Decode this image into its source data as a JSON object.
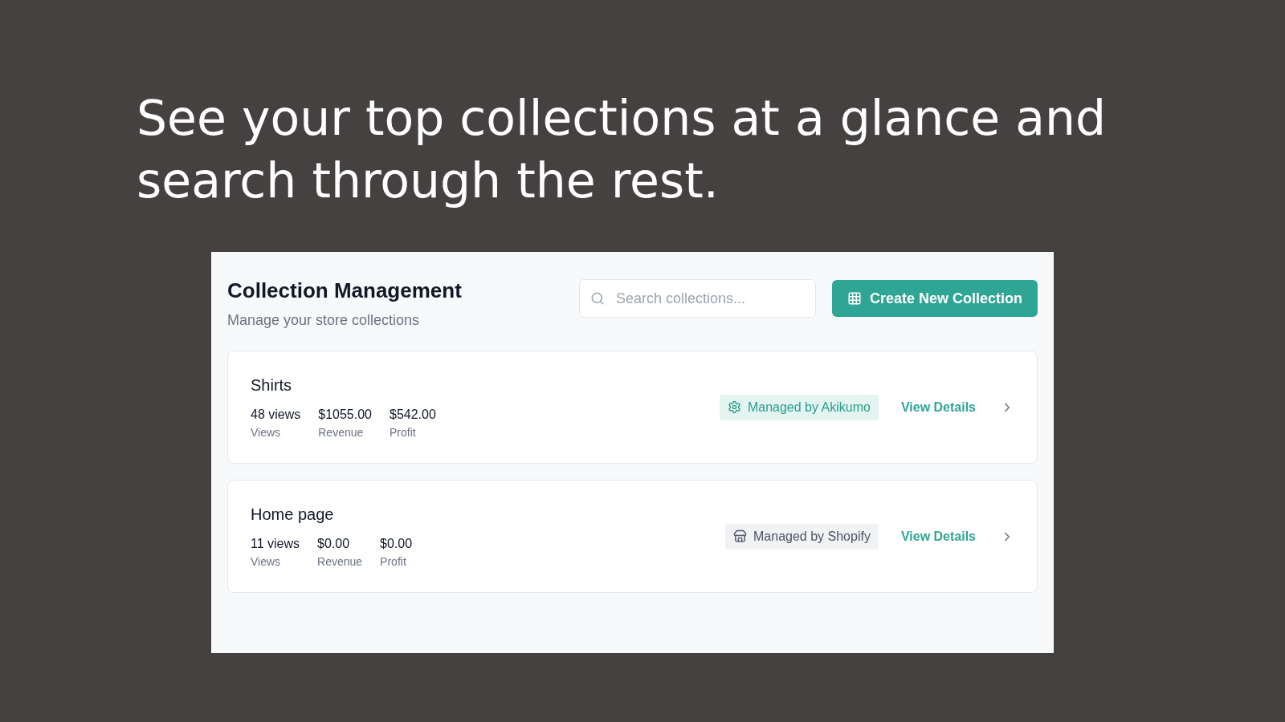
{
  "headline": "See your top collections at a glance and search through the rest.",
  "header": {
    "title": "Collection Management",
    "subtitle": "Manage your store collections"
  },
  "search": {
    "placeholder": "Search collections..."
  },
  "create_button": {
    "label": "Create New Collection"
  },
  "collections": [
    {
      "name": "Shirts",
      "stats": [
        {
          "value": "48 views",
          "label": "Views"
        },
        {
          "value": "$1055.00",
          "label": "Revenue"
        },
        {
          "value": "$542.00",
          "label": "Profit"
        }
      ],
      "badge": {
        "kind": "app",
        "label": "Managed by Akikumo"
      },
      "link": "View Details"
    },
    {
      "name": "Home page",
      "stats": [
        {
          "value": "11 views",
          "label": "Views"
        },
        {
          "value": "$0.00",
          "label": "Revenue"
        },
        {
          "value": "$0.00",
          "label": "Profit"
        }
      ],
      "badge": {
        "kind": "store",
        "label": "Managed by Shopify"
      },
      "link": "View Details"
    }
  ]
}
